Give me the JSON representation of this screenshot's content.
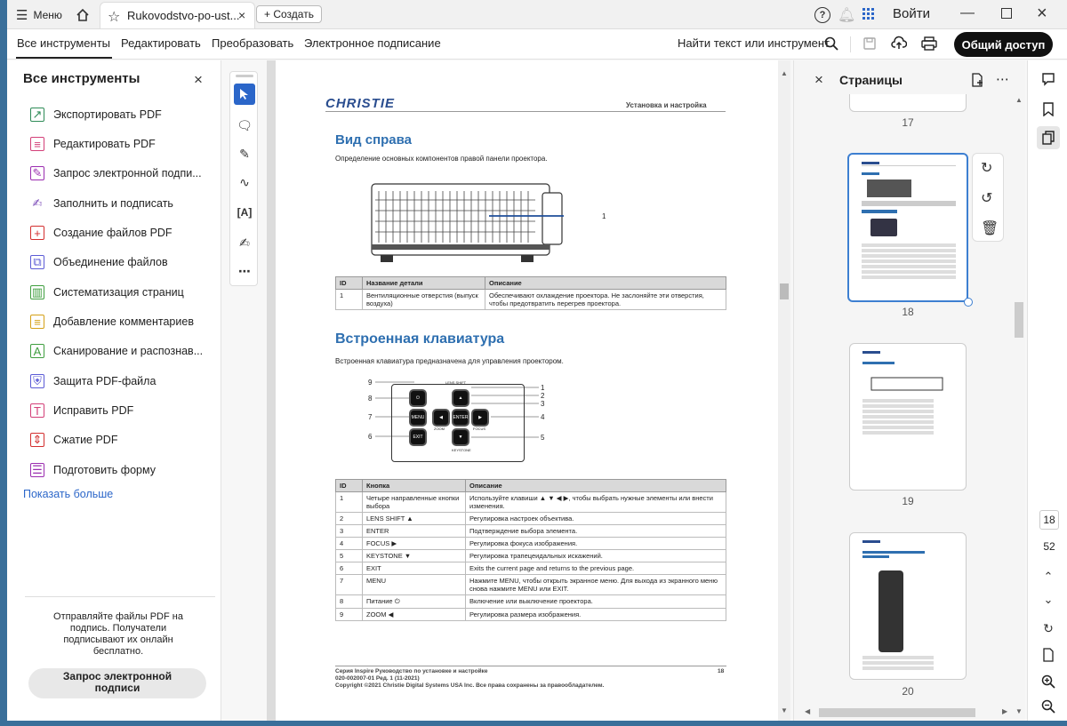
{
  "titlebar": {
    "menu_label": "Меню",
    "tab_title": "Rukovodstvo-po-ust...",
    "create_label": "+ Создать",
    "signin_label": "Войти"
  },
  "menubar": {
    "items": [
      "Все инструменты",
      "Редактировать",
      "Преобразовать",
      "Электронное подписание"
    ],
    "search_label": "Найти текст или инструмент",
    "share_label": "Общий доступ"
  },
  "left_panel": {
    "title": "Все инструменты",
    "tools": [
      {
        "label": "Экспортировать PDF",
        "color": "#2e8b57",
        "icon": "export-icon"
      },
      {
        "label": "Редактировать PDF",
        "color": "#d33f78",
        "icon": "edit-pdf-icon"
      },
      {
        "label": "Запрос электронной подпи...",
        "color": "#9b2db0",
        "icon": "request-sign-icon"
      },
      {
        "label": "Заполнить и подписать",
        "color": "#7b4bb8",
        "icon": "fill-sign-icon"
      },
      {
        "label": "Создание файлов PDF",
        "color": "#d32f2f",
        "icon": "create-pdf-icon"
      },
      {
        "label": "Объединение файлов",
        "color": "#5b5bd6",
        "icon": "combine-icon"
      },
      {
        "label": "Систематизация страниц",
        "color": "#3f9e3f",
        "icon": "organize-icon"
      },
      {
        "label": "Добавление комментариев",
        "color": "#d4a017",
        "icon": "comment-icon"
      },
      {
        "label": "Сканирование и распознав...",
        "color": "#3f9e3f",
        "icon": "scan-icon"
      },
      {
        "label": "Защита PDF-файла",
        "color": "#5b5bd6",
        "icon": "protect-icon"
      },
      {
        "label": "Исправить PDF",
        "color": "#d33f78",
        "icon": "redact-icon"
      },
      {
        "label": "Сжатие PDF",
        "color": "#d32f2f",
        "icon": "compress-icon"
      },
      {
        "label": "Подготовить форму",
        "color": "#9b2db0",
        "icon": "form-icon"
      }
    ],
    "show_more": "Показать больше",
    "promo_text": "Отправляйте файлы PDF на подпись. Получатели подписывают их онлайн бесплатно.",
    "promo_button": "Запрос электронной подписи"
  },
  "document": {
    "brand": "CHRISTIE",
    "header_right": "Установка и настройка",
    "section1_title": "Вид справа",
    "section1_intro": "Определение основных компонентов правой панели проектора.",
    "callout1": "1",
    "table1": {
      "headers": [
        "ID",
        "Название детали",
        "Описание"
      ],
      "rows": [
        [
          "1",
          "Вентиляционные отверстия (выпуск воздуха)",
          "Обеспечивают охлаждение проектора. Не заслоняйте эти отверстия, чтобы предотвратить перегрев проектора."
        ]
      ]
    },
    "section2_title": "Встроенная клавиатура",
    "section2_intro": "Встроенная клавиатура предназначена для управления проектором.",
    "keypad": {
      "labels_left": [
        "9",
        "8",
        "7",
        "6"
      ],
      "labels_right": [
        "1",
        "2",
        "3",
        "4",
        "5"
      ],
      "lens_shift": "LENS SHIFT",
      "zoom": "ZOOM",
      "focus": "FOCUS",
      "keystone": "KEYSTONE",
      "menu": "MENU",
      "exit": "EXIT",
      "enter": "ENTER"
    },
    "table2": {
      "headers": [
        "ID",
        "Кнопка",
        "Описание"
      ],
      "rows": [
        [
          "1",
          "Четыре направленные кнопки выбора",
          "Используйте клавиши ▲ ▼ ◀ ▶, чтобы выбрать нужные элементы или внести изменения."
        ],
        [
          "2",
          "LENS SHIFT ▲",
          "Регулировка настроек объектива."
        ],
        [
          "3",
          "ENTER",
          "Подтверждение выбора элемента."
        ],
        [
          "4",
          "FOCUS ▶",
          "Регулировка фокуса изображения."
        ],
        [
          "5",
          "KEYSTONE ▼",
          "Регулировка трапецеидальных искажений."
        ],
        [
          "6",
          "EXIT",
          "Exits the current page and returns to the previous page."
        ],
        [
          "7",
          "MENU",
          "Нажмите MENU, чтобы открыть экранное меню. Для выхода из экранного меню снова нажмите MENU или EXIT."
        ],
        [
          "8",
          "Питание ⏻",
          "Включение или выключение проектора."
        ],
        [
          "9",
          "ZOOM ◀",
          "Регулировка размера изображения."
        ]
      ]
    },
    "footer_line1": "Серия Inspire Руководство по установке и настройке",
    "footer_page": "18",
    "footer_line2": "020-002007-01 Ред. 1 (11-2021)",
    "footer_line3": "Copyright ©2021 Christie Digital Systems USA Inc. Все права сохранены за правообладателем."
  },
  "right_panel": {
    "title": "Страницы",
    "pages": [
      "17",
      "18",
      "19",
      "20"
    ],
    "accent": "#3d7fd1"
  },
  "right_bar": {
    "current_page": "18",
    "total_pages": "52"
  }
}
